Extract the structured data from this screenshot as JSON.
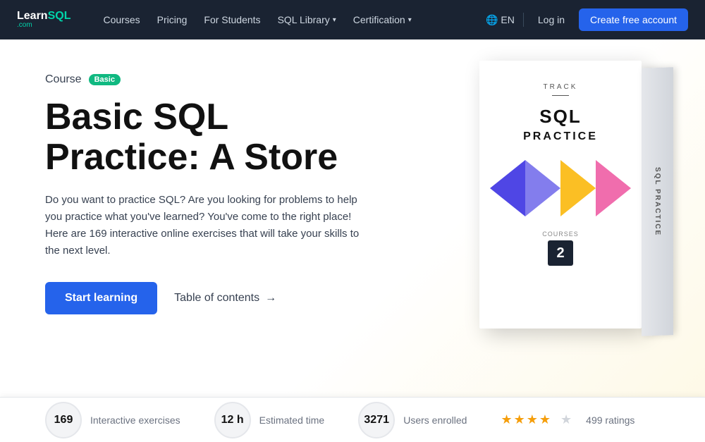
{
  "navbar": {
    "logo_top": "LearnSQL",
    "logo_highlight": "SQL",
    "logo_bottom": ".com",
    "links": [
      {
        "label": "Courses",
        "has_dropdown": false
      },
      {
        "label": "Pricing",
        "has_dropdown": false
      },
      {
        "label": "For Students",
        "has_dropdown": false
      },
      {
        "label": "SQL Library",
        "has_dropdown": true
      },
      {
        "label": "Certification",
        "has_dropdown": true
      }
    ],
    "lang": "EN",
    "login_label": "Log in",
    "create_account_label": "Create free account"
  },
  "hero": {
    "course_text": "Course",
    "badge_text": "Basic",
    "title_line1": "Basic SQL",
    "title_line2": "Practice: A Store",
    "description": "Do you want to practice SQL? Are you looking for problems to help you practice what you've learned? You've come to the right place! Here are 169 interactive online exercises that will take your skills to the next level.",
    "start_button": "Start learning",
    "toc_link": "Table of contents",
    "toc_arrow": "→"
  },
  "book": {
    "track_label": "TRACK",
    "title": "SQL",
    "subtitle": "PRACTICE",
    "courses_label": "COURSES",
    "courses_count": "2",
    "spine_text": "SQL PRACTICE"
  },
  "stats": [
    {
      "value": "169",
      "label": "Interactive exercises"
    },
    {
      "value": "12 h",
      "label": "Estimated time"
    },
    {
      "value": "3271",
      "label": "Users enrolled"
    }
  ],
  "ratings": {
    "stars": 4.5,
    "count": "499 ratings"
  }
}
